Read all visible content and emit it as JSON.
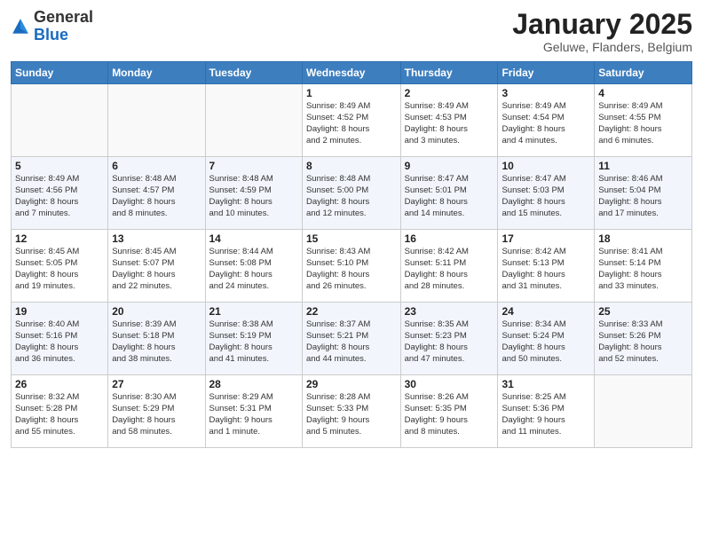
{
  "header": {
    "logo_general": "General",
    "logo_blue": "Blue",
    "month_title": "January 2025",
    "subtitle": "Geluwe, Flanders, Belgium"
  },
  "weekdays": [
    "Sunday",
    "Monday",
    "Tuesday",
    "Wednesday",
    "Thursday",
    "Friday",
    "Saturday"
  ],
  "weeks": [
    [
      {
        "day": "",
        "info": ""
      },
      {
        "day": "",
        "info": ""
      },
      {
        "day": "",
        "info": ""
      },
      {
        "day": "1",
        "info": "Sunrise: 8:49 AM\nSunset: 4:52 PM\nDaylight: 8 hours\nand 2 minutes."
      },
      {
        "day": "2",
        "info": "Sunrise: 8:49 AM\nSunset: 4:53 PM\nDaylight: 8 hours\nand 3 minutes."
      },
      {
        "day": "3",
        "info": "Sunrise: 8:49 AM\nSunset: 4:54 PM\nDaylight: 8 hours\nand 4 minutes."
      },
      {
        "day": "4",
        "info": "Sunrise: 8:49 AM\nSunset: 4:55 PM\nDaylight: 8 hours\nand 6 minutes."
      }
    ],
    [
      {
        "day": "5",
        "info": "Sunrise: 8:49 AM\nSunset: 4:56 PM\nDaylight: 8 hours\nand 7 minutes."
      },
      {
        "day": "6",
        "info": "Sunrise: 8:48 AM\nSunset: 4:57 PM\nDaylight: 8 hours\nand 8 minutes."
      },
      {
        "day": "7",
        "info": "Sunrise: 8:48 AM\nSunset: 4:59 PM\nDaylight: 8 hours\nand 10 minutes."
      },
      {
        "day": "8",
        "info": "Sunrise: 8:48 AM\nSunset: 5:00 PM\nDaylight: 8 hours\nand 12 minutes."
      },
      {
        "day": "9",
        "info": "Sunrise: 8:47 AM\nSunset: 5:01 PM\nDaylight: 8 hours\nand 14 minutes."
      },
      {
        "day": "10",
        "info": "Sunrise: 8:47 AM\nSunset: 5:03 PM\nDaylight: 8 hours\nand 15 minutes."
      },
      {
        "day": "11",
        "info": "Sunrise: 8:46 AM\nSunset: 5:04 PM\nDaylight: 8 hours\nand 17 minutes."
      }
    ],
    [
      {
        "day": "12",
        "info": "Sunrise: 8:45 AM\nSunset: 5:05 PM\nDaylight: 8 hours\nand 19 minutes."
      },
      {
        "day": "13",
        "info": "Sunrise: 8:45 AM\nSunset: 5:07 PM\nDaylight: 8 hours\nand 22 minutes."
      },
      {
        "day": "14",
        "info": "Sunrise: 8:44 AM\nSunset: 5:08 PM\nDaylight: 8 hours\nand 24 minutes."
      },
      {
        "day": "15",
        "info": "Sunrise: 8:43 AM\nSunset: 5:10 PM\nDaylight: 8 hours\nand 26 minutes."
      },
      {
        "day": "16",
        "info": "Sunrise: 8:42 AM\nSunset: 5:11 PM\nDaylight: 8 hours\nand 28 minutes."
      },
      {
        "day": "17",
        "info": "Sunrise: 8:42 AM\nSunset: 5:13 PM\nDaylight: 8 hours\nand 31 minutes."
      },
      {
        "day": "18",
        "info": "Sunrise: 8:41 AM\nSunset: 5:14 PM\nDaylight: 8 hours\nand 33 minutes."
      }
    ],
    [
      {
        "day": "19",
        "info": "Sunrise: 8:40 AM\nSunset: 5:16 PM\nDaylight: 8 hours\nand 36 minutes."
      },
      {
        "day": "20",
        "info": "Sunrise: 8:39 AM\nSunset: 5:18 PM\nDaylight: 8 hours\nand 38 minutes."
      },
      {
        "day": "21",
        "info": "Sunrise: 8:38 AM\nSunset: 5:19 PM\nDaylight: 8 hours\nand 41 minutes."
      },
      {
        "day": "22",
        "info": "Sunrise: 8:37 AM\nSunset: 5:21 PM\nDaylight: 8 hours\nand 44 minutes."
      },
      {
        "day": "23",
        "info": "Sunrise: 8:35 AM\nSunset: 5:23 PM\nDaylight: 8 hours\nand 47 minutes."
      },
      {
        "day": "24",
        "info": "Sunrise: 8:34 AM\nSunset: 5:24 PM\nDaylight: 8 hours\nand 50 minutes."
      },
      {
        "day": "25",
        "info": "Sunrise: 8:33 AM\nSunset: 5:26 PM\nDaylight: 8 hours\nand 52 minutes."
      }
    ],
    [
      {
        "day": "26",
        "info": "Sunrise: 8:32 AM\nSunset: 5:28 PM\nDaylight: 8 hours\nand 55 minutes."
      },
      {
        "day": "27",
        "info": "Sunrise: 8:30 AM\nSunset: 5:29 PM\nDaylight: 8 hours\nand 58 minutes."
      },
      {
        "day": "28",
        "info": "Sunrise: 8:29 AM\nSunset: 5:31 PM\nDaylight: 9 hours\nand 1 minute."
      },
      {
        "day": "29",
        "info": "Sunrise: 8:28 AM\nSunset: 5:33 PM\nDaylight: 9 hours\nand 5 minutes."
      },
      {
        "day": "30",
        "info": "Sunrise: 8:26 AM\nSunset: 5:35 PM\nDaylight: 9 hours\nand 8 minutes."
      },
      {
        "day": "31",
        "info": "Sunrise: 8:25 AM\nSunset: 5:36 PM\nDaylight: 9 hours\nand 11 minutes."
      },
      {
        "day": "",
        "info": ""
      }
    ]
  ]
}
